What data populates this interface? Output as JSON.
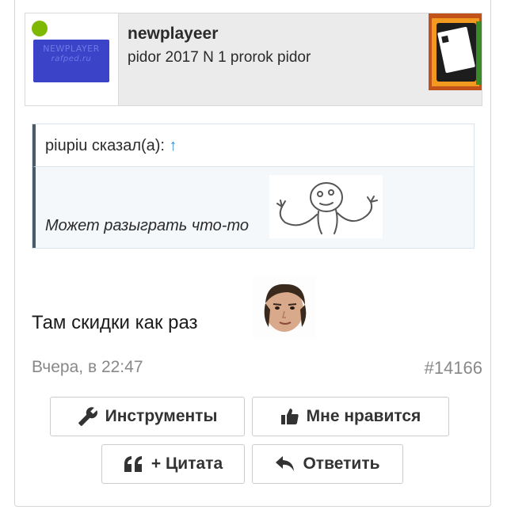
{
  "author": {
    "name": "newplayeer",
    "title": "pidor 2017 N 1 prorok pidor",
    "online": true,
    "avatar_text_line1": "NEWPLAYER",
    "avatar_text_line2": "rafped.ru",
    "avatar_color": "#3b44c8",
    "online_color": "#7fb800"
  },
  "quote": {
    "author_text": "piupiu сказал(а): ",
    "jump_link": "↑",
    "body": "Может разыграть что-то ",
    "smiley": "shrug-smiley"
  },
  "message": {
    "text": "Там скидки как раз ",
    "smiley": "kappa-smiley"
  },
  "meta": {
    "date": "Вчера, в 22:47",
    "post_number": "#14166"
  },
  "actions": {
    "tools_label": "Инструменты",
    "like_label": "Мне нравится",
    "quote_label": "+ Цитата",
    "reply_label": "Ответить"
  },
  "colors": {
    "link": "#3a8fd8",
    "quote_bar": "#4a5a66",
    "muted_text": "#888888"
  }
}
